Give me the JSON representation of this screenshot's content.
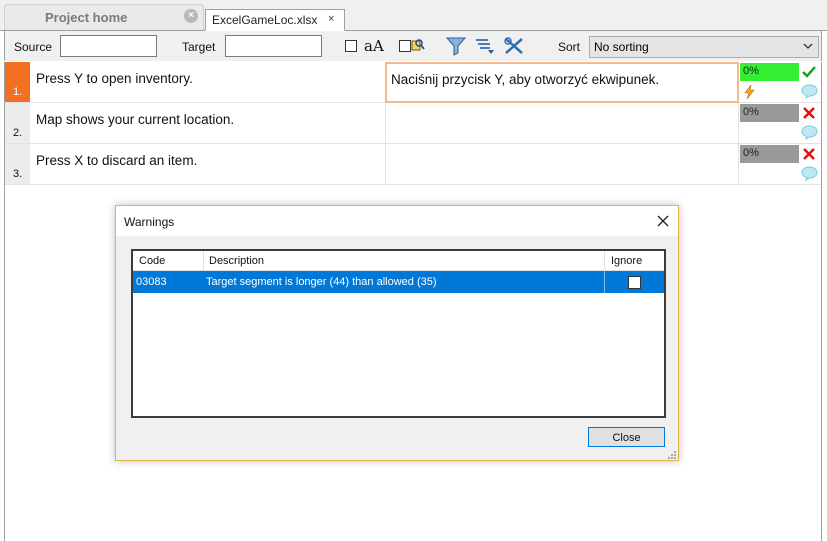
{
  "tabs": {
    "home": {
      "label": "Project home",
      "close": "×"
    },
    "file": {
      "label": "ExcelGameLoc.xlsx",
      "close": "×"
    }
  },
  "toolbar": {
    "source_label": "Source",
    "source_value": "",
    "target_label": "Target",
    "target_value": "",
    "match_case_label": "aA",
    "sort_label": "Sort",
    "sort_value": "No sorting"
  },
  "rows": [
    {
      "num": "1.",
      "source": "Press Y to open inventory.",
      "target": "Naciśnij przycisk Y, aby otworzyć ekwipunek.",
      "progress": "0%",
      "progress_fraction": 0.0,
      "progress_color": "#33ee33",
      "status": "confirmed"
    },
    {
      "num": "2.",
      "source": "Map shows your current location.",
      "target": "",
      "progress": "0%",
      "progress_fraction": 0.0,
      "progress_color": "#999999",
      "status": "error"
    },
    {
      "num": "3.",
      "source": "Press X to discard an item.",
      "target": "",
      "progress": "0%",
      "progress_fraction": 0.0,
      "progress_color": "#999999",
      "status": "error"
    }
  ],
  "dialog": {
    "title": "Warnings",
    "columns": {
      "code": "Code",
      "description": "Description",
      "ignore": "Ignore"
    },
    "warnings": [
      {
        "code": "03083",
        "description": "Target segment is longer (44) than allowed (35)",
        "ignore": false
      }
    ],
    "close_label": "Close"
  },
  "colors": {
    "active_row": "#f36f21",
    "selection": "#0078d7",
    "dialog_border": "#e5b34c",
    "progress_done": "#33ee33"
  }
}
